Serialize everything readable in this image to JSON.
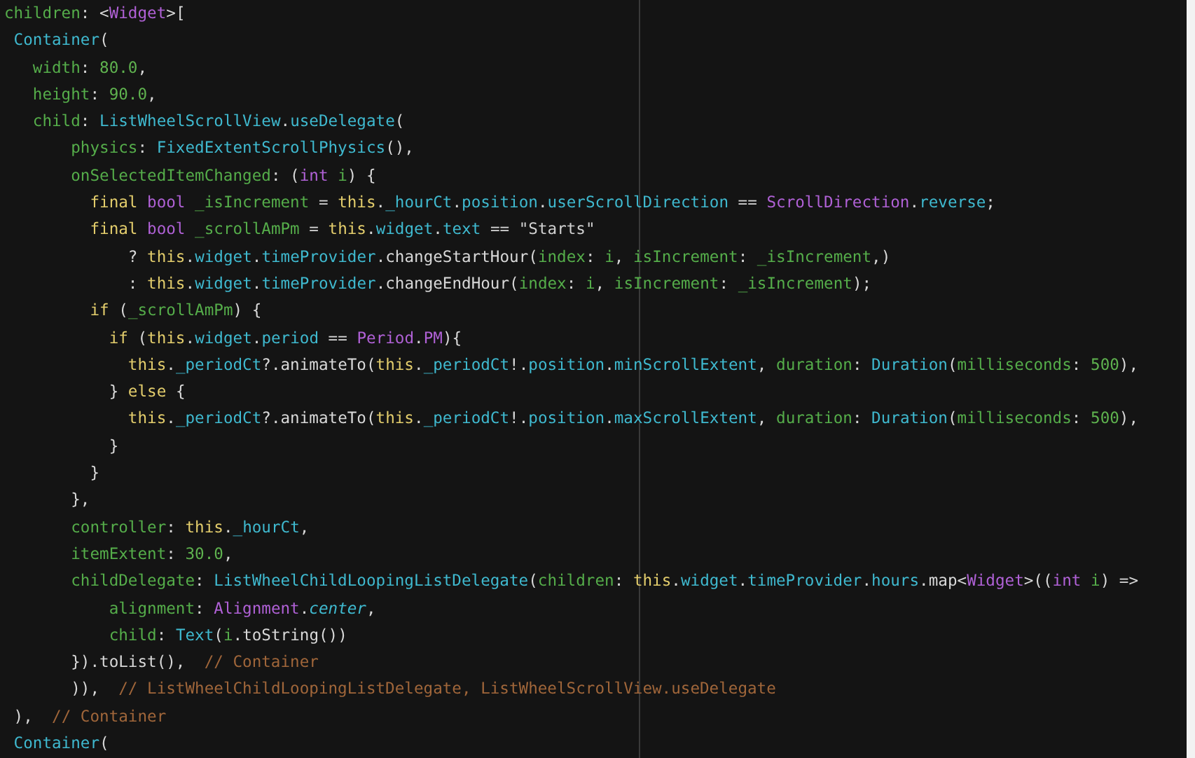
{
  "editor": {
    "lines": [
      [
        {
          "kind": "param",
          "t": "children"
        },
        {
          "kind": "plain",
          "t": ": <"
        },
        {
          "kind": "type",
          "t": "Widget"
        },
        {
          "kind": "plain",
          "t": ">["
        }
      ],
      [
        {
          "kind": "identifier",
          "t": " Container"
        },
        {
          "kind": "plain",
          "t": "("
        }
      ],
      [
        {
          "kind": "param",
          "t": "   width"
        },
        {
          "kind": "plain",
          "t": ": "
        },
        {
          "kind": "number",
          "t": "80.0"
        },
        {
          "kind": "plain",
          "t": ","
        }
      ],
      [
        {
          "kind": "param",
          "t": "   height"
        },
        {
          "kind": "plain",
          "t": ": "
        },
        {
          "kind": "number",
          "t": "90.0"
        },
        {
          "kind": "plain",
          "t": ","
        }
      ],
      [
        {
          "kind": "param",
          "t": "   child"
        },
        {
          "kind": "plain",
          "t": ": "
        },
        {
          "kind": "identifier",
          "t": "ListWheelScrollView"
        },
        {
          "kind": "plain",
          "t": "."
        },
        {
          "kind": "identifier",
          "t": "useDelegate"
        },
        {
          "kind": "plain",
          "t": "("
        }
      ],
      [
        {
          "kind": "param",
          "t": "       physics"
        },
        {
          "kind": "plain",
          "t": ": "
        },
        {
          "kind": "identifier",
          "t": "FixedExtentScrollPhysics"
        },
        {
          "kind": "plain",
          "t": "(),"
        }
      ],
      [
        {
          "kind": "param",
          "t": "       onSelectedItemChanged"
        },
        {
          "kind": "plain",
          "t": ": ("
        },
        {
          "kind": "type",
          "t": "int "
        },
        {
          "kind": "param",
          "t": "i"
        },
        {
          "kind": "plain",
          "t": ") {"
        }
      ],
      [
        {
          "kind": "keyword",
          "t": "         final "
        },
        {
          "kind": "type",
          "t": "bool "
        },
        {
          "kind": "param",
          "t": "_isIncrement"
        },
        {
          "kind": "plain",
          "t": " = "
        },
        {
          "kind": "keyword",
          "t": "this"
        },
        {
          "kind": "plain",
          "t": "."
        },
        {
          "kind": "identifier",
          "t": "_hourCt"
        },
        {
          "kind": "plain",
          "t": "."
        },
        {
          "kind": "identifier",
          "t": "position"
        },
        {
          "kind": "plain",
          "t": "."
        },
        {
          "kind": "identifier",
          "t": "userScrollDirection"
        },
        {
          "kind": "plain",
          "t": " == "
        },
        {
          "kind": "type",
          "t": "ScrollDirection"
        },
        {
          "kind": "plain",
          "t": "."
        },
        {
          "kind": "identifier",
          "t": "reverse"
        },
        {
          "kind": "plain",
          "t": ";"
        }
      ],
      [
        {
          "kind": "keyword",
          "t": "         final "
        },
        {
          "kind": "type",
          "t": "bool "
        },
        {
          "kind": "param",
          "t": "_scrollAmPm"
        },
        {
          "kind": "plain",
          "t": " = "
        },
        {
          "kind": "keyword",
          "t": "this"
        },
        {
          "kind": "plain",
          "t": "."
        },
        {
          "kind": "identifier",
          "t": "widget"
        },
        {
          "kind": "plain",
          "t": "."
        },
        {
          "kind": "identifier",
          "t": "text"
        },
        {
          "kind": "plain",
          "t": " == "
        },
        {
          "kind": "string",
          "t": "\"Starts\""
        }
      ],
      [
        {
          "kind": "plain",
          "t": "             ? "
        },
        {
          "kind": "keyword",
          "t": "this"
        },
        {
          "kind": "plain",
          "t": "."
        },
        {
          "kind": "identifier",
          "t": "widget"
        },
        {
          "kind": "plain",
          "t": "."
        },
        {
          "kind": "identifier",
          "t": "timeProvider"
        },
        {
          "kind": "plain",
          "t": ".changeStartHour("
        },
        {
          "kind": "param",
          "t": "index"
        },
        {
          "kind": "plain",
          "t": ": "
        },
        {
          "kind": "param",
          "t": "i"
        },
        {
          "kind": "plain",
          "t": ", "
        },
        {
          "kind": "param",
          "t": "isIncrement"
        },
        {
          "kind": "plain",
          "t": ": "
        },
        {
          "kind": "param",
          "t": "_isIncrement"
        },
        {
          "kind": "plain",
          "t": ",)"
        }
      ],
      [
        {
          "kind": "plain",
          "t": "             : "
        },
        {
          "kind": "keyword",
          "t": "this"
        },
        {
          "kind": "plain",
          "t": "."
        },
        {
          "kind": "identifier",
          "t": "widget"
        },
        {
          "kind": "plain",
          "t": "."
        },
        {
          "kind": "identifier",
          "t": "timeProvider"
        },
        {
          "kind": "plain",
          "t": ".changeEndHour("
        },
        {
          "kind": "param",
          "t": "index"
        },
        {
          "kind": "plain",
          "t": ": "
        },
        {
          "kind": "param",
          "t": "i"
        },
        {
          "kind": "plain",
          "t": ", "
        },
        {
          "kind": "param",
          "t": "isIncrement"
        },
        {
          "kind": "plain",
          "t": ": "
        },
        {
          "kind": "param",
          "t": "_isIncrement"
        },
        {
          "kind": "plain",
          "t": ");"
        }
      ],
      [
        {
          "kind": "keyword",
          "t": "         if"
        },
        {
          "kind": "plain",
          "t": " ("
        },
        {
          "kind": "param",
          "t": "_scrollAmPm"
        },
        {
          "kind": "plain",
          "t": ") {"
        }
      ],
      [
        {
          "kind": "keyword",
          "t": "           if"
        },
        {
          "kind": "plain",
          "t": " ("
        },
        {
          "kind": "keyword",
          "t": "this"
        },
        {
          "kind": "plain",
          "t": "."
        },
        {
          "kind": "identifier",
          "t": "widget"
        },
        {
          "kind": "plain",
          "t": "."
        },
        {
          "kind": "identifier",
          "t": "period"
        },
        {
          "kind": "plain",
          "t": " == "
        },
        {
          "kind": "type",
          "t": "Period"
        },
        {
          "kind": "plain",
          "t": "."
        },
        {
          "kind": "type",
          "t": "PM"
        },
        {
          "kind": "plain",
          "t": "){"
        }
      ],
      [
        {
          "kind": "keyword",
          "t": "             this"
        },
        {
          "kind": "plain",
          "t": "."
        },
        {
          "kind": "identifier",
          "t": "_periodCt"
        },
        {
          "kind": "plain",
          "t": "?.animateTo("
        },
        {
          "kind": "keyword",
          "t": "this"
        },
        {
          "kind": "plain",
          "t": "."
        },
        {
          "kind": "identifier",
          "t": "_periodCt"
        },
        {
          "kind": "plain",
          "t": "!."
        },
        {
          "kind": "identifier",
          "t": "position"
        },
        {
          "kind": "plain",
          "t": "."
        },
        {
          "kind": "identifier",
          "t": "minScrollExtent"
        },
        {
          "kind": "plain",
          "t": ", "
        },
        {
          "kind": "param",
          "t": "duration"
        },
        {
          "kind": "plain",
          "t": ": "
        },
        {
          "kind": "identifier",
          "t": "Duration"
        },
        {
          "kind": "plain",
          "t": "("
        },
        {
          "kind": "param",
          "t": "milliseconds"
        },
        {
          "kind": "plain",
          "t": ": "
        },
        {
          "kind": "number",
          "t": "500"
        },
        {
          "kind": "plain",
          "t": "),"
        }
      ],
      [
        {
          "kind": "plain",
          "t": "           } "
        },
        {
          "kind": "keyword",
          "t": "else"
        },
        {
          "kind": "plain",
          "t": " {"
        }
      ],
      [
        {
          "kind": "keyword",
          "t": "             this"
        },
        {
          "kind": "plain",
          "t": "."
        },
        {
          "kind": "identifier",
          "t": "_periodCt"
        },
        {
          "kind": "plain",
          "t": "?.animateTo("
        },
        {
          "kind": "keyword",
          "t": "this"
        },
        {
          "kind": "plain",
          "t": "."
        },
        {
          "kind": "identifier",
          "t": "_periodCt"
        },
        {
          "kind": "plain",
          "t": "!."
        },
        {
          "kind": "identifier",
          "t": "position"
        },
        {
          "kind": "plain",
          "t": "."
        },
        {
          "kind": "identifier",
          "t": "maxScrollExtent"
        },
        {
          "kind": "plain",
          "t": ", "
        },
        {
          "kind": "param",
          "t": "duration"
        },
        {
          "kind": "plain",
          "t": ": "
        },
        {
          "kind": "identifier",
          "t": "Duration"
        },
        {
          "kind": "plain",
          "t": "("
        },
        {
          "kind": "param",
          "t": "milliseconds"
        },
        {
          "kind": "plain",
          "t": ": "
        },
        {
          "kind": "number",
          "t": "500"
        },
        {
          "kind": "plain",
          "t": "),"
        }
      ],
      [
        {
          "kind": "plain",
          "t": "           }"
        }
      ],
      [
        {
          "kind": "plain",
          "t": "         }"
        }
      ],
      [
        {
          "kind": "plain",
          "t": "       },"
        }
      ],
      [
        {
          "kind": "param",
          "t": "       controller"
        },
        {
          "kind": "plain",
          "t": ": "
        },
        {
          "kind": "keyword",
          "t": "this"
        },
        {
          "kind": "plain",
          "t": "."
        },
        {
          "kind": "identifier",
          "t": "_hourCt"
        },
        {
          "kind": "plain",
          "t": ","
        }
      ],
      [
        {
          "kind": "param",
          "t": "       itemExtent"
        },
        {
          "kind": "plain",
          "t": ": "
        },
        {
          "kind": "number",
          "t": "30.0"
        },
        {
          "kind": "plain",
          "t": ","
        }
      ],
      [
        {
          "kind": "param",
          "t": "       childDelegate"
        },
        {
          "kind": "plain",
          "t": ": "
        },
        {
          "kind": "identifier",
          "t": "ListWheelChildLoopingListDelegate"
        },
        {
          "kind": "plain",
          "t": "("
        },
        {
          "kind": "param",
          "t": "children"
        },
        {
          "kind": "plain",
          "t": ": "
        },
        {
          "kind": "keyword",
          "t": "this"
        },
        {
          "kind": "plain",
          "t": "."
        },
        {
          "kind": "identifier",
          "t": "widget"
        },
        {
          "kind": "plain",
          "t": "."
        },
        {
          "kind": "identifier",
          "t": "timeProvider"
        },
        {
          "kind": "plain",
          "t": "."
        },
        {
          "kind": "identifier",
          "t": "hours"
        },
        {
          "kind": "plain",
          "t": ".map<"
        },
        {
          "kind": "type",
          "t": "Widget"
        },
        {
          "kind": "plain",
          "t": ">(("
        },
        {
          "kind": "type",
          "t": "int "
        },
        {
          "kind": "param",
          "t": "i"
        },
        {
          "kind": "plain",
          "t": ") =>"
        }
      ],
      [
        {
          "kind": "param",
          "t": "           alignment"
        },
        {
          "kind": "plain",
          "t": ": "
        },
        {
          "kind": "type",
          "t": "Alignment"
        },
        {
          "kind": "plain",
          "t": "."
        },
        {
          "kind": "italic",
          "t": "center"
        },
        {
          "kind": "plain",
          "t": ","
        }
      ],
      [
        {
          "kind": "param",
          "t": "           child"
        },
        {
          "kind": "plain",
          "t": ": "
        },
        {
          "kind": "identifier",
          "t": "Text"
        },
        {
          "kind": "plain",
          "t": "("
        },
        {
          "kind": "param",
          "t": "i"
        },
        {
          "kind": "plain",
          "t": ".toString())"
        }
      ],
      [
        {
          "kind": "plain",
          "t": "       }).toList(),  "
        },
        {
          "kind": "comment",
          "t": "// Container"
        }
      ],
      [
        {
          "kind": "plain",
          "t": "       )),  "
        },
        {
          "kind": "comment",
          "t": "// ListWheelChildLoopingListDelegate, ListWheelScrollView.useDelegate"
        }
      ],
      [
        {
          "kind": "plain",
          "t": " ),  "
        },
        {
          "kind": "comment",
          "t": "// Container"
        }
      ],
      [
        {
          "kind": "identifier",
          "t": " Container"
        },
        {
          "kind": "plain",
          "t": "("
        }
      ]
    ]
  }
}
